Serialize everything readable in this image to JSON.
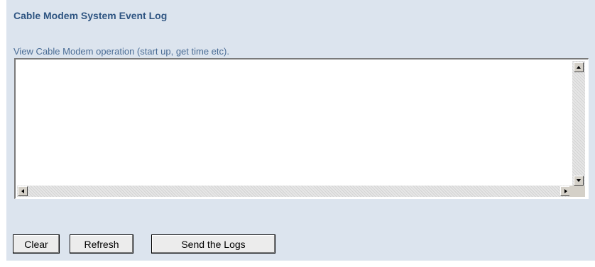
{
  "header": {
    "title": "Cable Modem System Event Log"
  },
  "log": {
    "description": "View Cable Modem operation (start up, get time etc).",
    "content": ""
  },
  "buttons": {
    "clear_label": "Clear",
    "refresh_label": "Refresh",
    "send_logs_label": "Send the Logs"
  },
  "colors": {
    "panel_background": "#dce4ee",
    "title_text": "#2f5582",
    "description_text": "#4a6c95"
  }
}
